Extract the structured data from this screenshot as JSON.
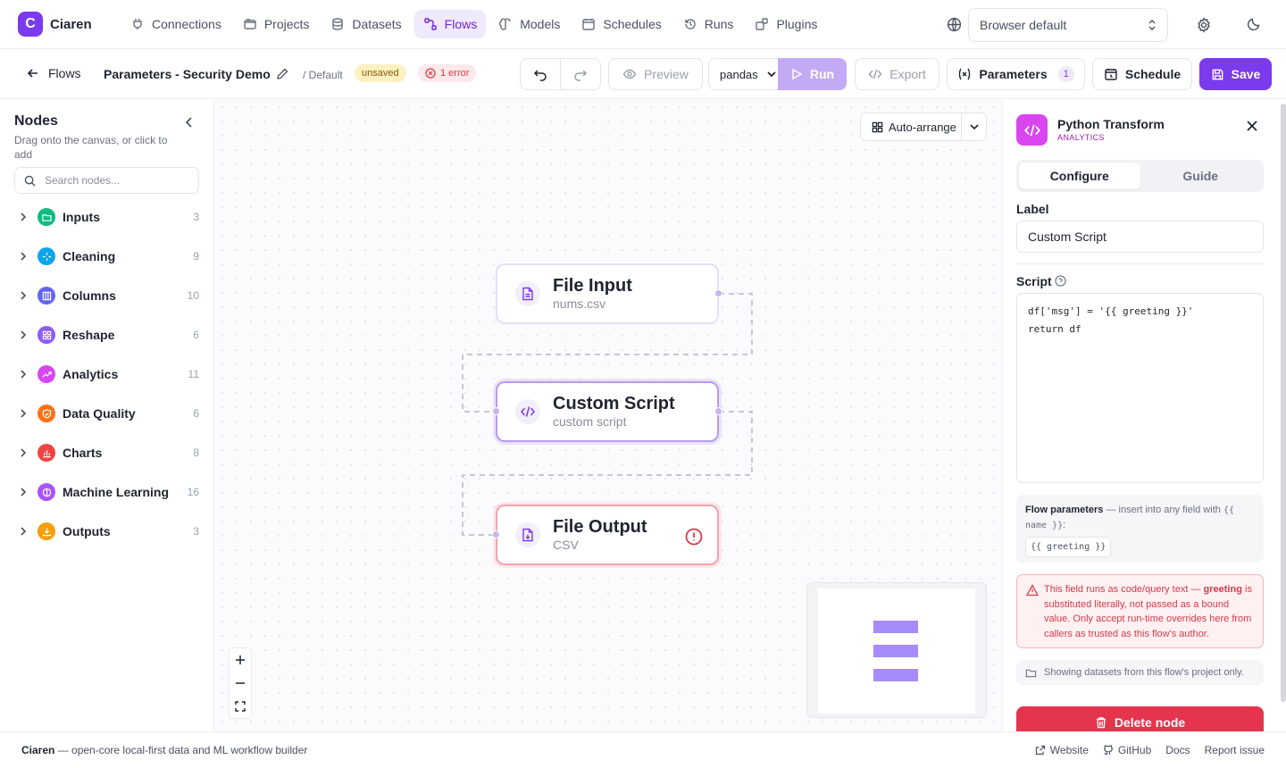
{
  "app": {
    "brand_letter": "C",
    "brand_name": "Ciaren",
    "accent": "#7c3aed"
  },
  "nav": {
    "items": [
      {
        "label": "Connections",
        "icon": "plug-icon"
      },
      {
        "label": "Projects",
        "icon": "folder-icon"
      },
      {
        "label": "Datasets",
        "icon": "database-icon"
      },
      {
        "label": "Flows",
        "icon": "flow-icon",
        "active": true
      },
      {
        "label": "Models",
        "icon": "brain-icon"
      },
      {
        "label": "Schedules",
        "icon": "calendar-icon"
      },
      {
        "label": "Runs",
        "icon": "history-icon"
      },
      {
        "label": "Plugins",
        "icon": "puzzle-icon"
      }
    ],
    "locale": "Browser default"
  },
  "toolbar": {
    "back_label": "Flows",
    "flow_title": "Parameters - Security Demo",
    "branch": "/ Default",
    "unsaved_badge": "unsaved",
    "error_badge": "1 error",
    "preview_label": "Preview",
    "engine": "pandas",
    "run_label": "Run",
    "export_label": "Export",
    "parameters_label": "Parameters",
    "parameters_count": "1",
    "schedule_label": "Schedule",
    "save_label": "Save"
  },
  "sidebar": {
    "title": "Nodes",
    "subtitle": "Drag onto the canvas, or click to add",
    "search_placeholder": "Search nodes...",
    "categories": [
      {
        "label": "Inputs",
        "count": "3",
        "color": "#10b981"
      },
      {
        "label": "Cleaning",
        "count": "9",
        "color": "#0ea5e9"
      },
      {
        "label": "Columns",
        "count": "10",
        "color": "#6366f1"
      },
      {
        "label": "Reshape",
        "count": "6",
        "color": "#8b5cf6"
      },
      {
        "label": "Analytics",
        "count": "11",
        "color": "#d946ef"
      },
      {
        "label": "Data Quality",
        "count": "6",
        "color": "#f97316"
      },
      {
        "label": "Charts",
        "count": "8",
        "color": "#ef4444"
      },
      {
        "label": "Machine Learning",
        "count": "16",
        "color": "#a855f7"
      },
      {
        "label": "Outputs",
        "count": "3",
        "color": "#f59e0b"
      }
    ]
  },
  "canvas": {
    "auto_arrange_label": "Auto-arrange",
    "nodes": [
      {
        "title": "File Input",
        "subtitle": "nums.csv"
      },
      {
        "title": "Custom Script",
        "subtitle": "custom script"
      },
      {
        "title": "File Output",
        "subtitle": "CSV"
      }
    ]
  },
  "inspector": {
    "title": "Python Transform",
    "category": "ANALYTICS",
    "tab_configure": "Configure",
    "tab_guide": "Guide",
    "label_caption": "Label",
    "label_value": "Custom Script",
    "script_caption": "Script",
    "script_code": "df['msg'] = '{{ greeting }}'\nreturn df",
    "params_title": "Flow parameters",
    "params_text": " — insert into any field with ",
    "params_syntax": "{{ name }}",
    "params_colon": ":",
    "params_chip": "{{ greeting }}",
    "warn_pre": "This field runs as code/query text — ",
    "warn_param": "greeting",
    "warn_post": " is substituted literally, not passed as a bound value. Only accept run-time overrides here from callers as trusted as this flow's author.",
    "info_text": "Showing datasets from this flow's project only.",
    "delete_label": "Delete node"
  },
  "footer": {
    "brand": "Ciaren",
    "tagline": " — open-core local-first data and ML workflow builder",
    "links": [
      "Website",
      "GitHub",
      "Docs",
      "Report issue"
    ]
  }
}
